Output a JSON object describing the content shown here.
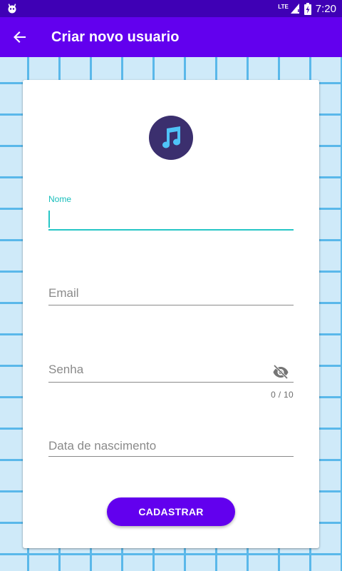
{
  "status_bar": {
    "network_label": "LTE",
    "time": "7:20"
  },
  "app_bar": {
    "title": "Criar novo usuario"
  },
  "form": {
    "name_field": {
      "label": "Nome",
      "value": ""
    },
    "email_field": {
      "placeholder": "Email"
    },
    "password_field": {
      "placeholder": "Senha",
      "counter": "0 / 10"
    },
    "birthdate_field": {
      "placeholder": "Data de nascimento"
    },
    "submit_label": "CADASTRAR"
  },
  "colors": {
    "status_bar": "#3f00b5",
    "app_bar": "#6200ee",
    "accent": "#17bebb",
    "button": "#6200ee",
    "avatar": "#3b2f6e",
    "grid_line": "#5ab8ea",
    "background": "#cfeaf9"
  },
  "icons": {
    "status_left": "android-debug-icon",
    "signal": "signal-icon",
    "battery": "battery-charging-icon",
    "back": "arrow-back-icon",
    "avatar": "music-note-icon",
    "password_toggle": "visibility-off-icon"
  }
}
